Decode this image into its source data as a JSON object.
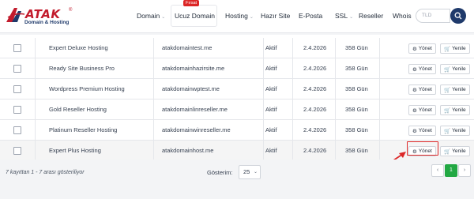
{
  "header": {
    "logo_text": "ATAK",
    "logo_sub": "Domain & Hosting",
    "logo_reg": "®",
    "nav": [
      {
        "label": "Domain",
        "dropdown": true
      },
      {
        "label": "Ucuz Domain",
        "badge": "Fırsat",
        "dropdown": false
      },
      {
        "label": "Hosting",
        "dropdown": true
      },
      {
        "label": "Hazır Site",
        "dropdown": false
      },
      {
        "label": "E-Posta",
        "dropdown": false
      },
      {
        "label": "SSL",
        "dropdown": true
      },
      {
        "label": "Reseller",
        "dropdown": false
      },
      {
        "label": "Whois",
        "dropdown": false
      }
    ],
    "search_placeholder": "TLD"
  },
  "table": {
    "rows": [
      {
        "product": "Expert Deluxe Hosting",
        "domain": "atakdomaintest.me",
        "status": "Aktif",
        "date": "2.4.2026",
        "days": "358 Gün"
      },
      {
        "product": "Ready Site Business Pro",
        "domain": "atakdomainhazirsite.me",
        "status": "Aktif",
        "date": "2.4.2026",
        "days": "358 Gün"
      },
      {
        "product": "Wordpress Premium Hosting",
        "domain": "atakdomainwptest.me",
        "status": "Aktif",
        "date": "2.4.2026",
        "days": "358 Gün"
      },
      {
        "product": "Gold Reseller Hosting",
        "domain": "atakdomainlinreseller.me",
        "status": "Aktif",
        "date": "2.4.2026",
        "days": "358 Gün"
      },
      {
        "product": "Platinum Reseller Hosting",
        "domain": "atakdomainwinreseller.me",
        "status": "Aktif",
        "date": "2.4.2026",
        "days": "358 Gün"
      },
      {
        "product": "Expert Plus Hosting",
        "domain": "atakdomainhost.me",
        "status": "Aktif",
        "date": "2.4.2026",
        "days": "358 Gün"
      }
    ],
    "manage_label": "Yönet",
    "renew_label": "Yenile"
  },
  "footer": {
    "summary": "7 kayıttan 1 - 7 arası gösteriliyor",
    "show_label": "Gösterim:",
    "show_value": "25",
    "prev": "‹",
    "current_page": "1",
    "next": "›"
  },
  "colors": {
    "brand_red": "#c21b2c",
    "brand_navy": "#1f3a6b",
    "page_active": "#22a843",
    "highlight": "#dc2626"
  }
}
